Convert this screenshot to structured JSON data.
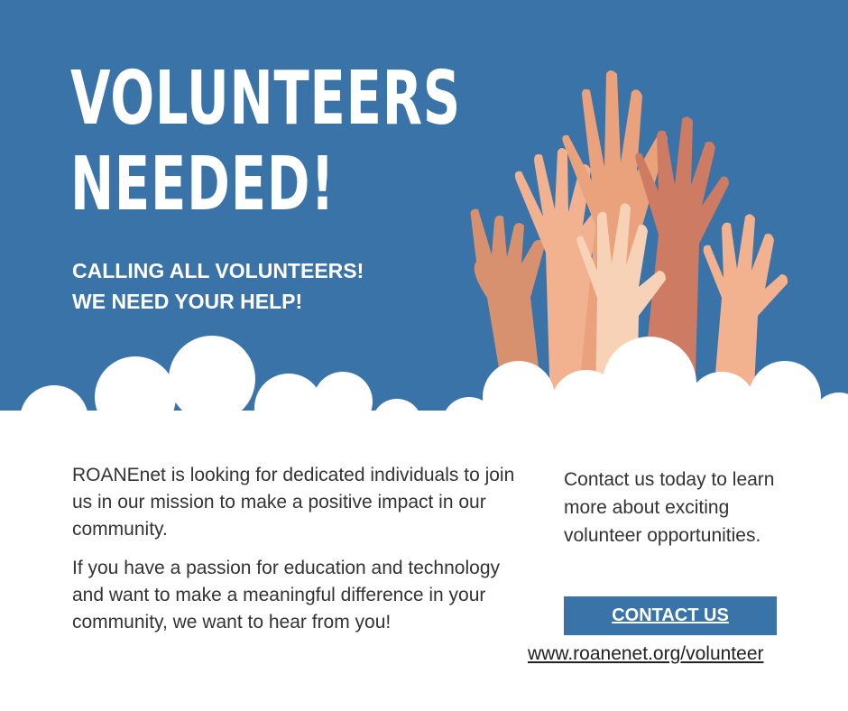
{
  "hero": {
    "headline_line1": "VOLUNTEERS",
    "headline_line2": "NEEDED!",
    "sub_line1": "CALLING ALL VOLUNTEERS!",
    "sub_line2": "WE NEED YOUR HELP!",
    "background_color": "#3a73a8"
  },
  "body": {
    "paragraph1": "ROANEnet is looking for dedicated individuals to join us in our mission to make a positive impact in our community.",
    "paragraph2": "If you have a passion for education and technology and want to make a meaningful difference in your community, we want to hear from you!"
  },
  "contact": {
    "text": "Contact us today to learn more about exciting volunteer opportunities.",
    "button_label": "CONTACT US",
    "url": "www.roanenet.org/volunteer"
  },
  "illustration": {
    "icon": "raised-hands-icon",
    "skin_colors": [
      "#d8916f",
      "#f2b18f",
      "#f7d2b6",
      "#cd7b62",
      "#e9a27c"
    ]
  }
}
